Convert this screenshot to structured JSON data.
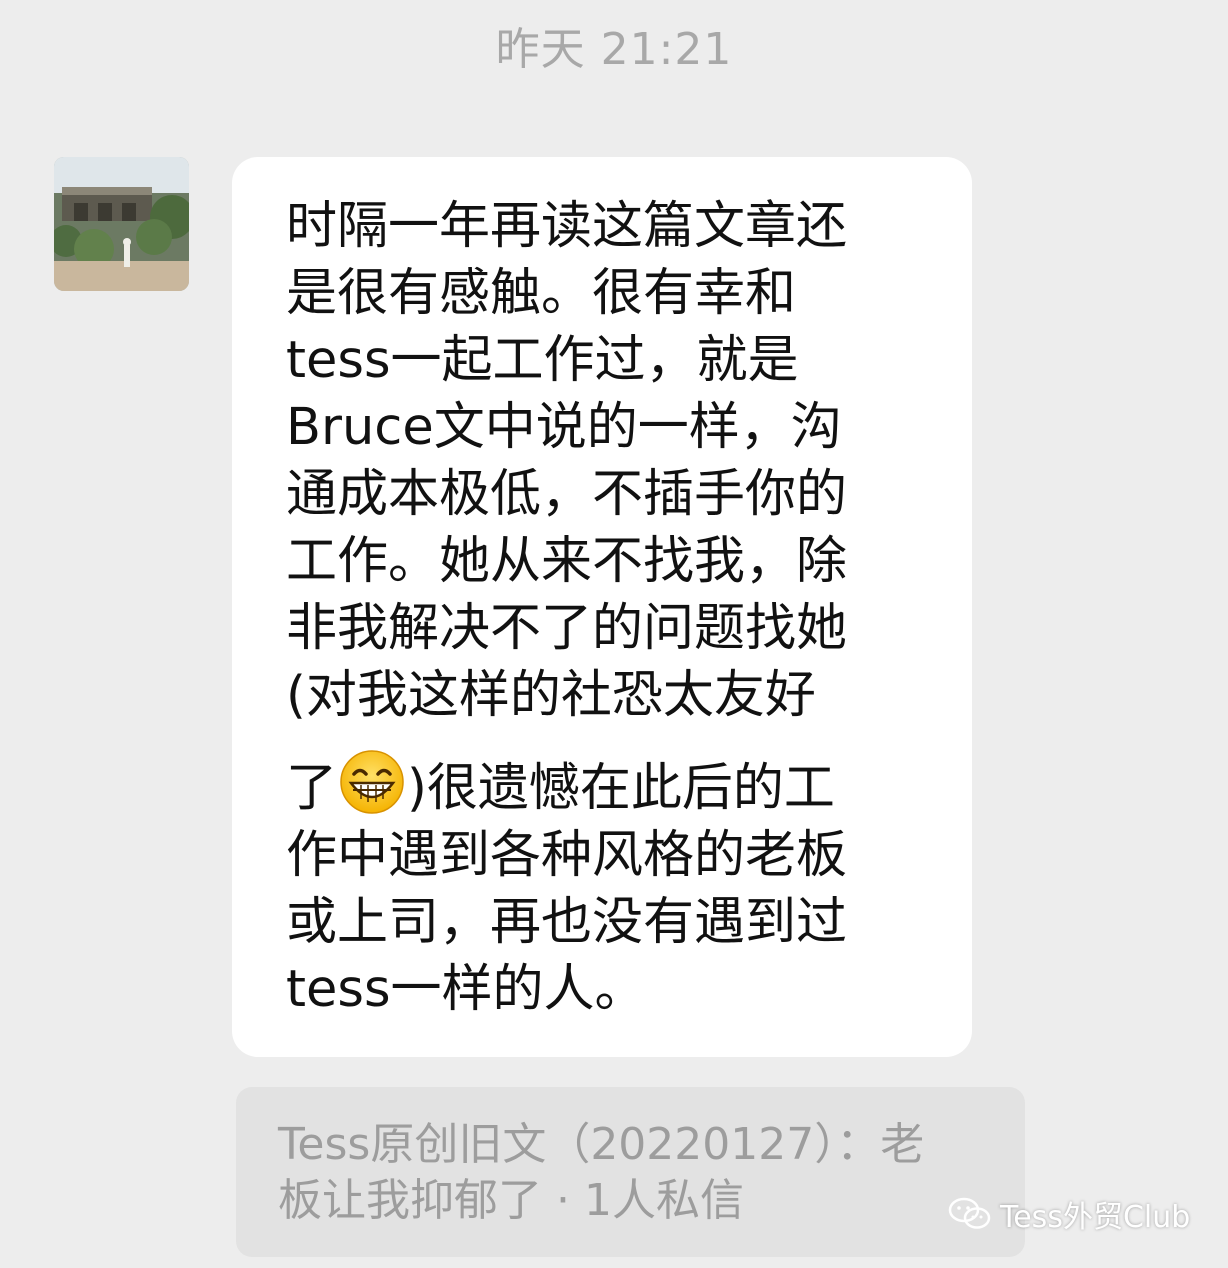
{
  "chat": {
    "timestamp": "昨天 21:21",
    "message": {
      "avatar_icon": "contact-avatar-photo",
      "lines": [
        "时隔一年再读这篇文章还",
        "是很有感触。很有幸和",
        "tess一起工作过，就是",
        "Bruce文中说的一样，沟",
        "通成本极低，不插手你的",
        "工作。她从来不找我，除",
        "非我解决不了的问题找她",
        "(对我这样的社恐太友好",
        "了",
        ")很遗憾在此后的工",
        "作中遇到各种风格的老板",
        "或上司，再也没有遇到过",
        "tess一样的人。"
      ],
      "emoji_icon": "grinning-face-emoji-icon"
    },
    "quote": {
      "line1": "Tess原创旧文（20220127）：老",
      "line2": "板让我抑郁了 · 1人私信"
    }
  },
  "watermark": {
    "icon": "wechat-icon",
    "text": "Tess外贸Club"
  },
  "colors": {
    "background": "#ededed",
    "bubble": "#ffffff",
    "quote_bg": "#e2e2e2",
    "timestamp_text": "#a8a8a8",
    "message_text": "#111111",
    "quote_text": "#9d9d9d"
  }
}
